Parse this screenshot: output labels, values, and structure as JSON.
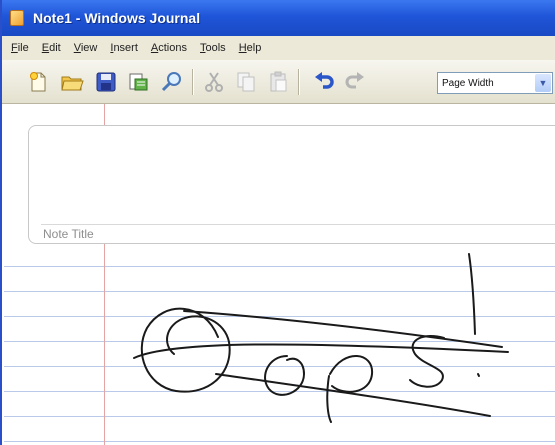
{
  "window": {
    "title": "Note1 - Windows Journal"
  },
  "menu": [
    {
      "mnemonic": "F",
      "rest": "ile"
    },
    {
      "mnemonic": "E",
      "rest": "dit"
    },
    {
      "mnemonic": "V",
      "rest": "iew"
    },
    {
      "mnemonic": "I",
      "rest": "nsert"
    },
    {
      "mnemonic": "A",
      "rest": "ctions"
    },
    {
      "mnemonic": "T",
      "rest": "ools"
    },
    {
      "mnemonic": "H",
      "rest": "elp"
    }
  ],
  "toolbar": {
    "icons": [
      "new-note-icon",
      "open-folder-icon",
      "save-disk-icon",
      "send-icon",
      "find-icon",
      "cut-icon",
      "copy-icon",
      "paste-icon",
      "undo-icon",
      "redo-icon"
    ],
    "zoom_value": "Page Width"
  },
  "note": {
    "title_placeholder": "Note Title",
    "ink_text": "Oops!"
  },
  "colors": {
    "titlebar": "#1f55d8",
    "margin_line": "#e5a4a4",
    "rule_lines": "#b9c9ea",
    "ink": "#1a1a1a"
  }
}
